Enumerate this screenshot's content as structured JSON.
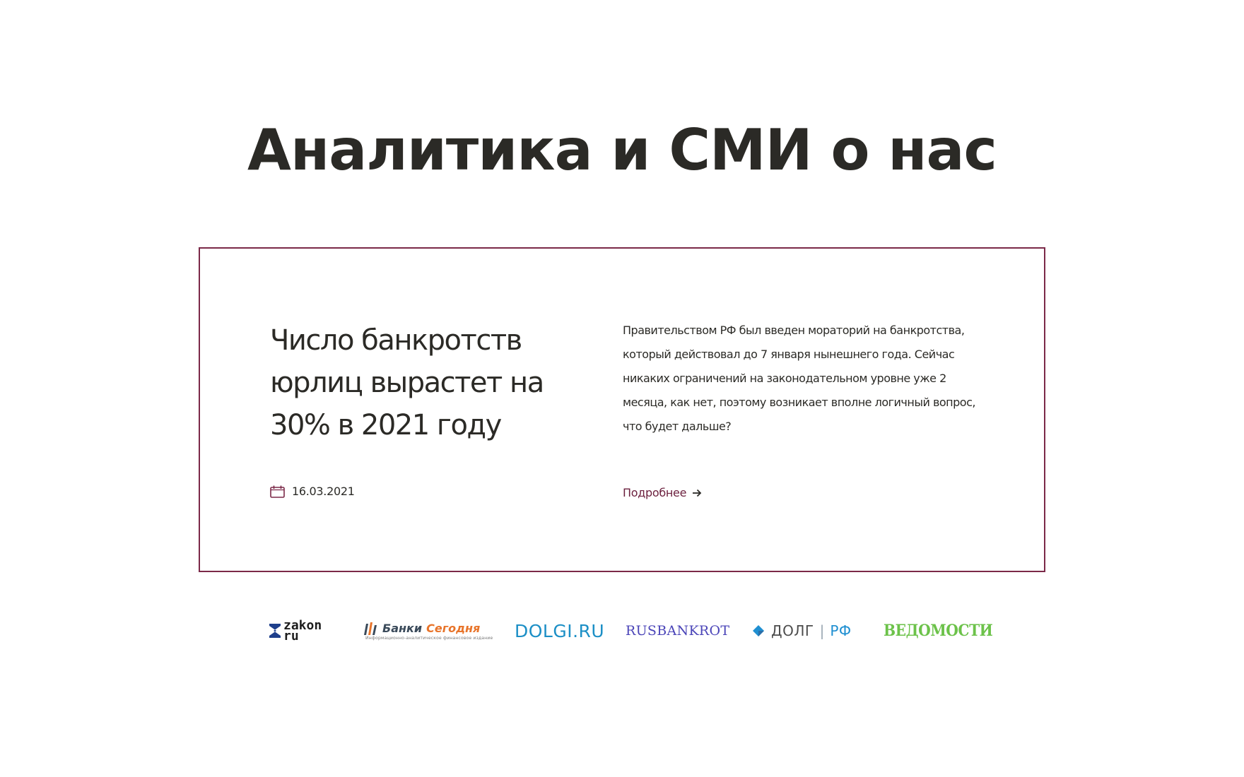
{
  "section": {
    "title": "Аналитика и СМИ о нас"
  },
  "article": {
    "title": "Число банкротств юрлиц вырастет на 30% в 2021 году",
    "text": "Правительством РФ был введен мораторий на банкротства, который действовал до 7 января нынешнего года. Сейчас никаких ограничений на законодательном уровне уже 2 месяца, как нет, поэтому возникает вполне логичный вопрос, что будет дальше?",
    "date": "16.03.2021",
    "date_icon": "calendar-icon",
    "more_label": "Подробнее",
    "more_icon": "arrow-right-icon",
    "border_color": "#7b2948",
    "accent_color": "#6b1f3d"
  },
  "media_logos": [
    {
      "id": "zakon",
      "line1": "zakon",
      "line2": "ru"
    },
    {
      "id": "banki",
      "name1": "Банки",
      "name2": "Сегодня",
      "subtitle": "Информационно-аналитическое финансовое издание"
    },
    {
      "id": "dolgi",
      "name": "DOLGI.RU"
    },
    {
      "id": "rusbankrot",
      "name": "RUSBANKROT"
    },
    {
      "id": "dolgrf",
      "name": "ДОЛГ",
      "suffix": "РФ"
    },
    {
      "id": "vedomosti",
      "name": "ВЕДОМОСТИ"
    }
  ]
}
